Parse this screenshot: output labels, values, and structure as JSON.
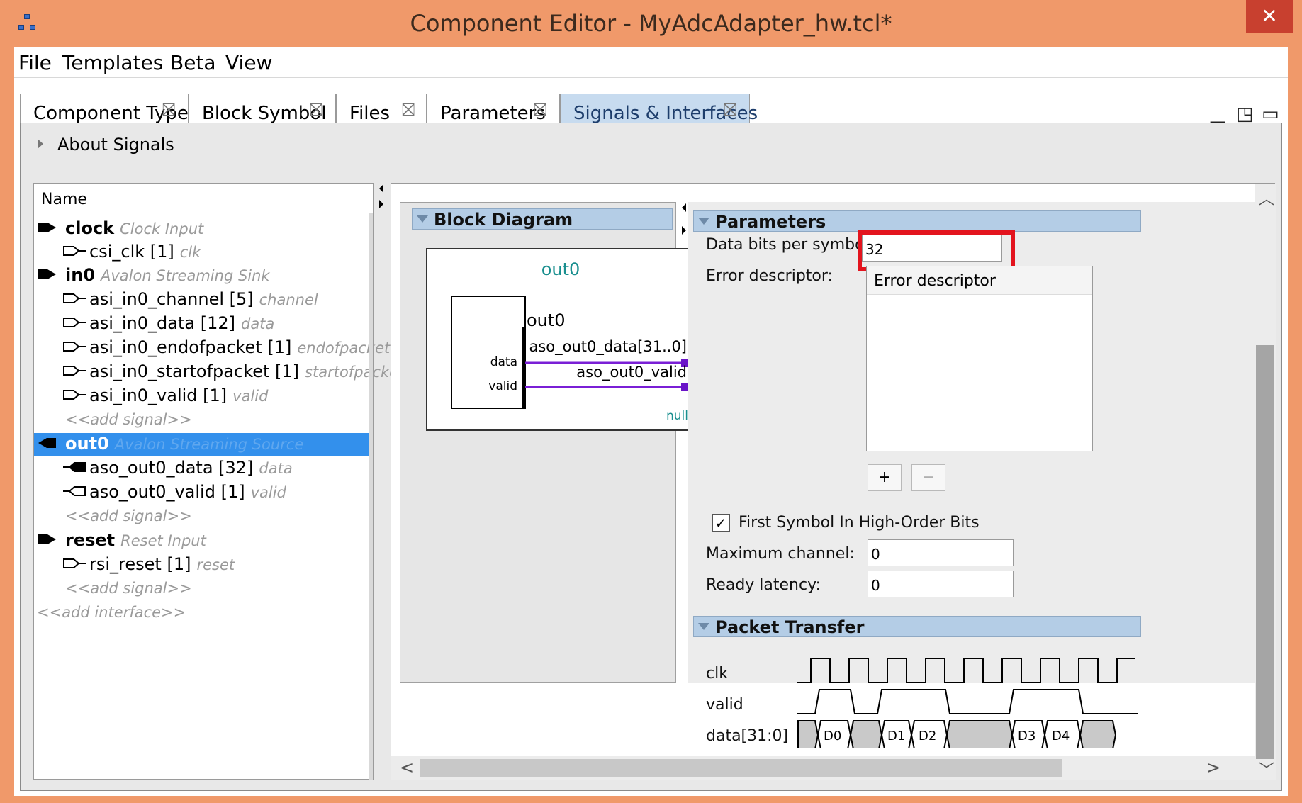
{
  "window": {
    "title": "Component Editor - MyAdcAdapter_hw.tcl*",
    "close": "✕"
  },
  "menu": {
    "file": "File",
    "templates": "Templates",
    "beta": "Beta",
    "view": "View"
  },
  "tabs": [
    {
      "label": "Component Type"
    },
    {
      "label": "Block Symbol"
    },
    {
      "label": "Files"
    },
    {
      "label": "Parameters"
    },
    {
      "label": "Signals & Interfaces"
    }
  ],
  "tab_close_glyph": "⛝",
  "window_controls": {
    "minimize": "▁",
    "restore": "◳",
    "maximize": "▭"
  },
  "about": {
    "label": "About Signals"
  },
  "tree": {
    "header": "Name",
    "clock": {
      "name": "clock",
      "type": "Clock Input"
    },
    "csi_clk": {
      "name": "csi_clk [1]",
      "role": "clk"
    },
    "in0": {
      "name": "in0",
      "type": "Avalon Streaming Sink"
    },
    "asi_channel": {
      "name": "asi_in0_channel [5]",
      "role": "channel"
    },
    "asi_data": {
      "name": "asi_in0_data [12]",
      "role": "data"
    },
    "asi_eop": {
      "name": "asi_in0_endofpacket [1]",
      "role": "endofpacket"
    },
    "asi_sop": {
      "name": "asi_in0_startofpacket [1]",
      "role": "startofpacket"
    },
    "asi_valid": {
      "name": "asi_in0_valid [1]",
      "role": "valid"
    },
    "add_signal": "<<add signal>>",
    "out0": {
      "name": "out0",
      "type": "Avalon Streaming Source"
    },
    "aso_data": {
      "name": "aso_out0_data [32]",
      "role": "data"
    },
    "aso_valid": {
      "name": "aso_out0_valid [1]",
      "role": "valid"
    },
    "reset": {
      "name": "reset",
      "type": "Reset Input"
    },
    "rsi_reset": {
      "name": "rsi_reset [1]",
      "role": "reset"
    },
    "add_interface": "<<add interface>>"
  },
  "block_diagram": {
    "header": "Block Diagram",
    "title": "out0",
    "inner_label": "out0",
    "data_label": "data",
    "valid_label": "valid",
    "data_signal": "aso_out0_data[31..0]",
    "valid_signal": "aso_out0_valid",
    "null_label": "null",
    "colors": {
      "teal": "#1a8f8f",
      "line": "#7a1fd6",
      "port": "#6a14c8"
    }
  },
  "parameters": {
    "header": "Parameters",
    "data_bits_label": "Data bits per symbol:",
    "data_bits_value": "32",
    "error_descriptor_label": "Error descriptor:",
    "error_descriptor_column": "Error descriptor",
    "add_btn": "+",
    "remove_btn": "−",
    "first_symbol_label": "First Symbol In High-Order Bits",
    "first_symbol_checked": "✓",
    "max_channel_label": "Maximum channel:",
    "max_channel_value": "0",
    "ready_latency_label": "Ready latency:",
    "ready_latency_value": "0"
  },
  "packet_transfer": {
    "header": "Packet Transfer",
    "clk_label": "clk",
    "valid_label": "valid",
    "data_label": "data[31:0]",
    "data_words": [
      "D0",
      "D1",
      "D2",
      "D3",
      "D4"
    ]
  },
  "scroll": {
    "up": "︿",
    "down": "﹀",
    "left": "<",
    "right": ">"
  },
  "colors": {
    "titlebar": "#f0996a",
    "selection": "#3390ec",
    "highlight": "#e3141e",
    "section": "#b4cde6"
  }
}
